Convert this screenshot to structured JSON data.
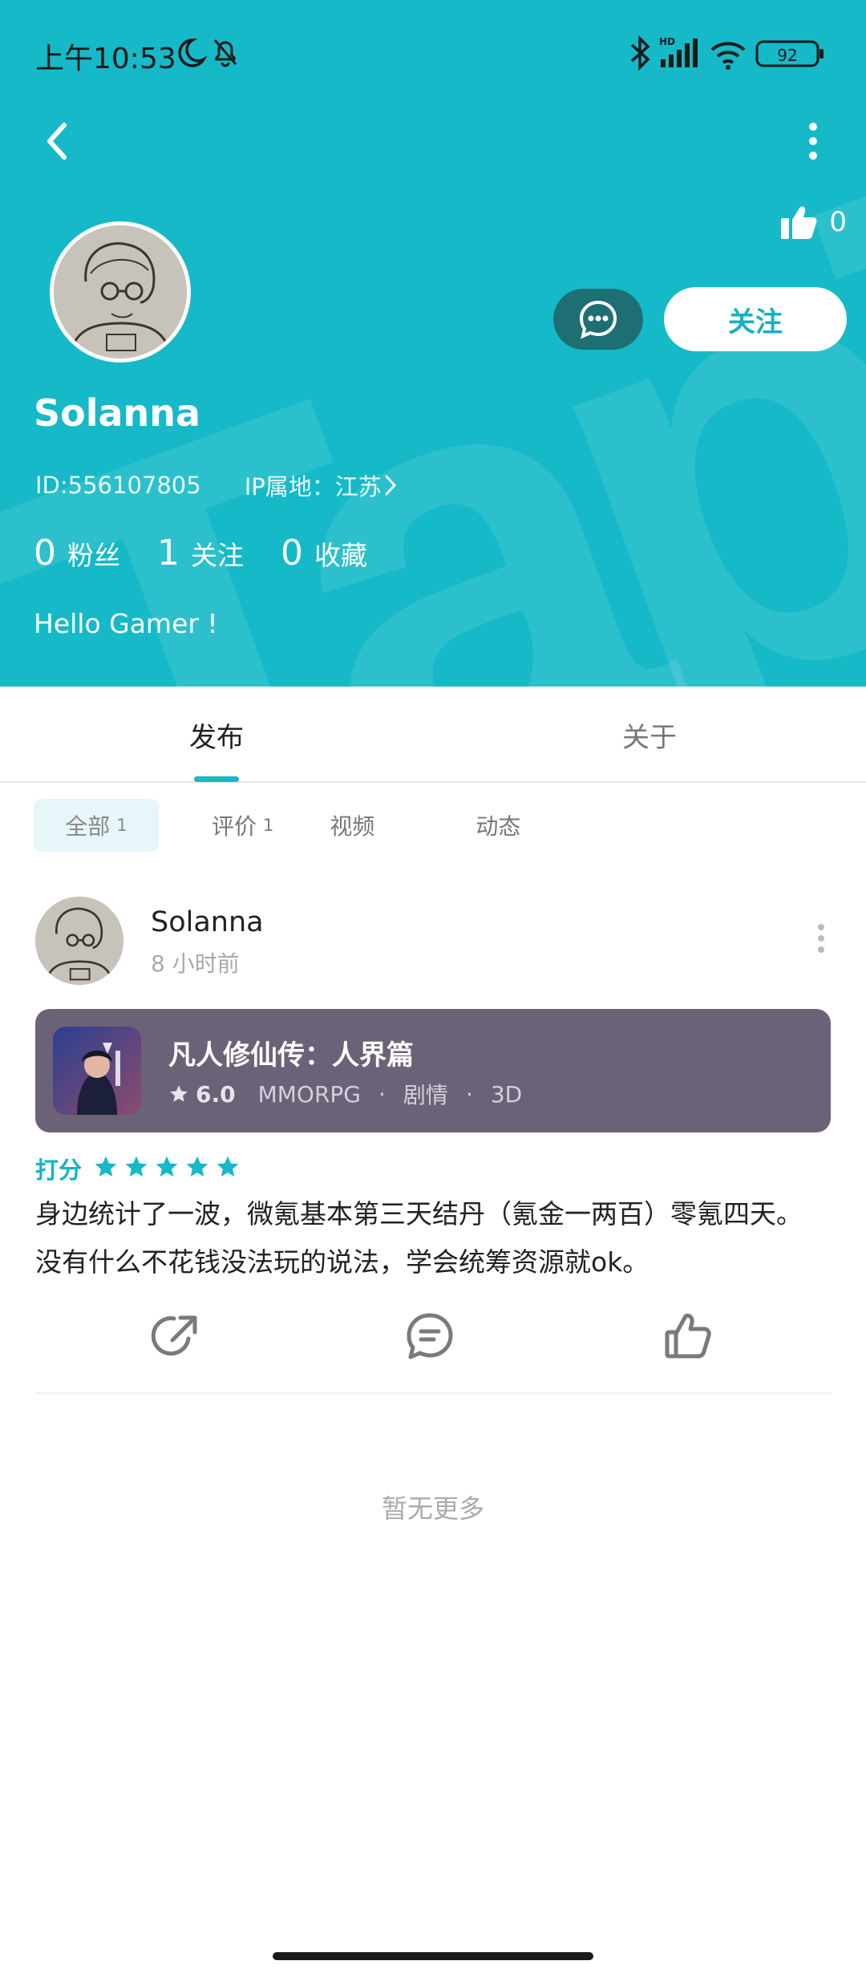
{
  "status_bar": {
    "time": "上午10:53",
    "battery": "92",
    "network_badge": "HD",
    "icons": [
      "moon-icon",
      "bell-off-icon",
      "bluetooth-icon",
      "signal-icon",
      "wifi-icon",
      "battery-icon"
    ]
  },
  "header": {
    "likes_count": "0",
    "follow_label": "关注",
    "username": "Solanna",
    "id_text": "ID:556107805",
    "ip_text": "IP属地：江苏",
    "stats": [
      {
        "count": "0",
        "label": "粉丝"
      },
      {
        "count": "1",
        "label": "关注"
      },
      {
        "count": "0",
        "label": "收藏"
      }
    ],
    "bio": "Hello Gamer !",
    "background_color": "#15b9c8"
  },
  "tabs": [
    {
      "label": "发布",
      "active": true
    },
    {
      "label": "关于",
      "active": false
    }
  ],
  "filters": [
    {
      "label": "全部",
      "count": "1",
      "active": true
    },
    {
      "label": "评价",
      "count": "1",
      "active": false
    },
    {
      "label": "视频",
      "count": "",
      "active": false
    },
    {
      "label": "动态",
      "count": "",
      "active": false
    }
  ],
  "post": {
    "author": "Solanna",
    "time": "8 小时前",
    "game": {
      "title": "凡人修仙传：人界篇",
      "score": "6.0",
      "genre": "MMORPG",
      "tag1": "剧情",
      "tag2": "3D",
      "dot": "·"
    },
    "rating_label": "打分",
    "stars": 5,
    "body_line1": "身边统计了一波，微氪基本第三天结丹（氪金一两百）零氪四天。",
    "body_line2": "没有什么不花钱没法玩的说法，学会统筹资源就ok。"
  },
  "footer": {
    "no_more": "暂无更多"
  },
  "colors": {
    "accent": "#15b9c8",
    "card": "#6b6278",
    "message_button": "#1e6f74"
  }
}
